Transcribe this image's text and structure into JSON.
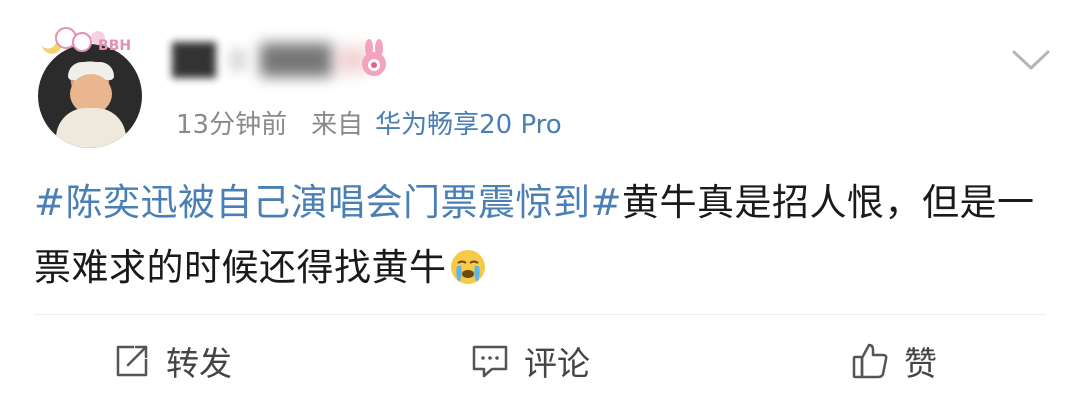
{
  "post": {
    "username": "",
    "time_ago": "13分钟前",
    "source_label": "来自",
    "source_device": "华为畅享20 Pro",
    "topic": "#陈奕迅被自己演唱会门票震惊到#",
    "text": "黄牛真是招人恨，但是一票难求的时候还得找黄牛"
  },
  "avatar_badge": {
    "text": "BBH"
  },
  "actions": {
    "repost": "转发",
    "comment": "评论",
    "like": "赞"
  },
  "icons": {
    "expand": "chevron-down-icon",
    "emoji": "crying-face-icon",
    "repost": "repost-icon",
    "comment": "comment-icon",
    "like": "thumbs-up-icon"
  }
}
